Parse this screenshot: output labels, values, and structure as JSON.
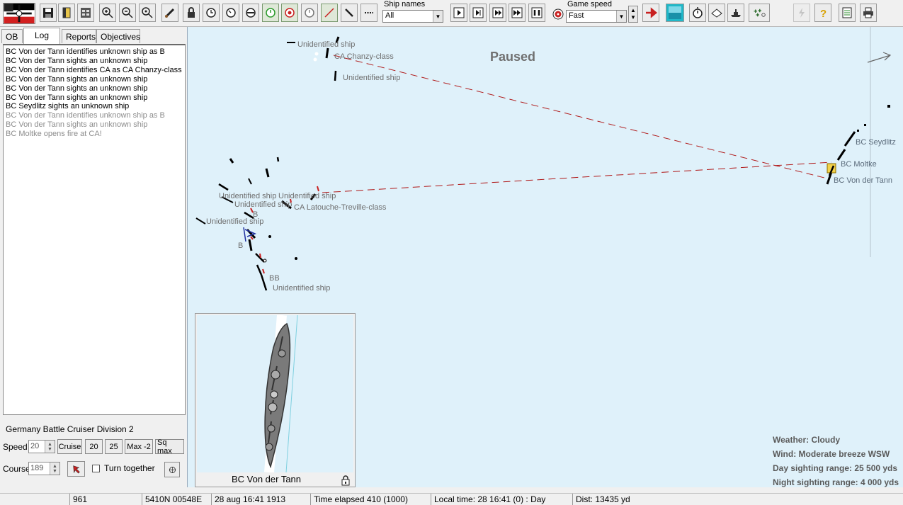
{
  "toolbar": {
    "ship_names_label": "Ship names",
    "ship_names_value": "All",
    "game_speed_label": "Game speed",
    "game_speed_value": "Fast",
    "flag_colors": [
      "#000000",
      "#ffffff",
      "#d21f1f"
    ]
  },
  "left_panel": {
    "tabs": [
      "OB",
      "Log",
      "Reports",
      "Objectives"
    ],
    "active_tab": "Log",
    "log": [
      {
        "text": "BC Von der Tann identifies unknown ship as B",
        "old": false
      },
      {
        "text": "BC Von der Tann sights an unknown ship",
        "old": false
      },
      {
        "text": "BC Von der Tann identifies CA as CA Chanzy-class",
        "old": false
      },
      {
        "text": "BC Von der Tann sights an unknown ship",
        "old": false
      },
      {
        "text": "BC Von der Tann sights an unknown ship",
        "old": false
      },
      {
        "text": "BC Von der Tann sights an unknown ship",
        "old": false
      },
      {
        "text": "BC Seydlitz sights an unknown ship",
        "old": false
      },
      {
        "text": "BC Von der Tann identifies unknown ship as B",
        "old": true
      },
      {
        "text": "BC Von der Tann sights an unknown ship",
        "old": true
      },
      {
        "text": "BC Moltke opens fire at CA!",
        "old": true
      }
    ],
    "division_title": "Germany Battle Cruiser Division 2",
    "speed_label": "Speed",
    "speed_value": "20",
    "speed_buttons": [
      "Cruise",
      "20",
      "25",
      "Max -2",
      "Sq max"
    ],
    "course_label": "Course",
    "course_value": "189",
    "turn_together_label": "Turn together"
  },
  "map": {
    "paused_label": "Paused",
    "labels": {
      "unidentified_top": "Unidentified ship",
      "chanzy": "CA Chanzy-class",
      "unidentified_2": "Unidentified ship",
      "seydlitz": "BC Seydlitz",
      "moltke": "BC Moltke",
      "von_der_tann": "BC Von der Tann",
      "unidentified_w1": "Unidentified ship",
      "unidentified_w2": "Unidentified ship",
      "unidentified_w3": "Unidentified ship",
      "latouche": "CA Latouche-Treville-class",
      "b_1": "B",
      "unidentified_w4": "Unidentified ship",
      "b_2": "B",
      "bb": "BB",
      "unidentified_w5": "Unidentified ship"
    },
    "weather": {
      "weather": "Weather: Cloudy",
      "wind": "Wind: Moderate breeze  WSW",
      "day_range": "Day sighting range: 25 500 yds",
      "night_range": "Night sighting range: 4 000 yds"
    },
    "fire_line_color": "#b01818",
    "sea_color": "#dff1fa"
  },
  "inset": {
    "ship_name": "BC Von der Tann"
  },
  "statusbar": {
    "turn": "961",
    "position": "5410N 00548E",
    "date": "28 aug 16:41 1913",
    "elapsed": "Time elapsed 410 (1000)",
    "local_time": "Local time: 28 16:41 (0) : Day",
    "distance": "Dist: 13435 yd"
  }
}
